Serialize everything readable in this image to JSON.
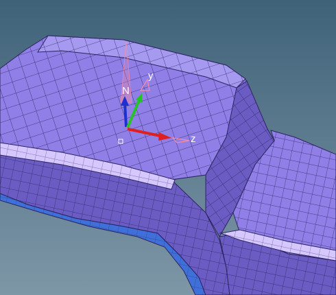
{
  "viewport": {
    "background_top": "#3f6279",
    "background_bottom": "#7e97a7"
  },
  "mesh": {
    "surface_color": "#8f7fe6",
    "surface_light_color": "#a69af0",
    "surface_dark_color": "#6a5cc2",
    "highlight_color": "#d6c8ff",
    "underside_color": "#3f6fd9",
    "edge_color": "#2b2360"
  },
  "triad": {
    "normal_label": "N",
    "y_label": "y",
    "z_label": "z",
    "normal_color": "#1f2fd1",
    "y_color": "#27c22a",
    "z_color": "#e01f1f",
    "ghost_color": "#ff8aa0"
  }
}
